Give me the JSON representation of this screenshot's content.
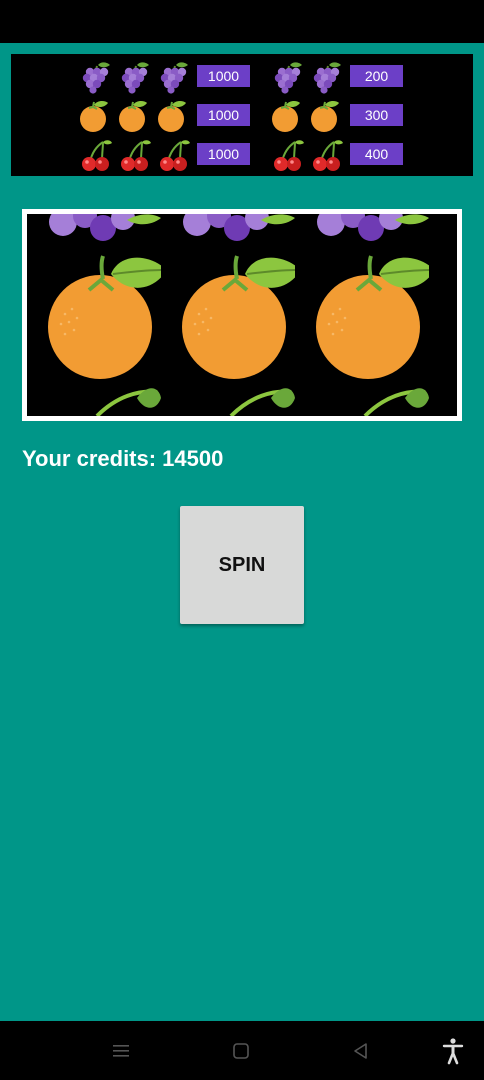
{
  "paytable": {
    "rows": [
      {
        "fruit": "grape",
        "three_of_kind_payout": "1000",
        "two_of_kind_payout": "200"
      },
      {
        "fruit": "orange",
        "three_of_kind_payout": "1000",
        "two_of_kind_payout": "300"
      },
      {
        "fruit": "cherry",
        "three_of_kind_payout": "1000",
        "two_of_kind_payout": "400"
      }
    ],
    "badge_color": "#6c3fc7"
  },
  "reels": [
    {
      "top": "grape",
      "center": "orange",
      "bottom": "cherry"
    },
    {
      "top": "grape",
      "center": "orange",
      "bottom": "cherry"
    },
    {
      "top": "grape",
      "center": "orange",
      "bottom": "cherry"
    }
  ],
  "credits": {
    "label": "Your credits: 14500"
  },
  "spin_button": {
    "label": "SPIN"
  },
  "colors": {
    "background": "#009688",
    "orange": "#f29c33",
    "grape": "#9b6fd0",
    "cherry": "#e02a2a",
    "leaf": "#8cc63f"
  },
  "nav_bar": {
    "icons": [
      "menu-icon",
      "home-square-icon",
      "back-triangle-icon",
      "accessibility-icon"
    ]
  }
}
